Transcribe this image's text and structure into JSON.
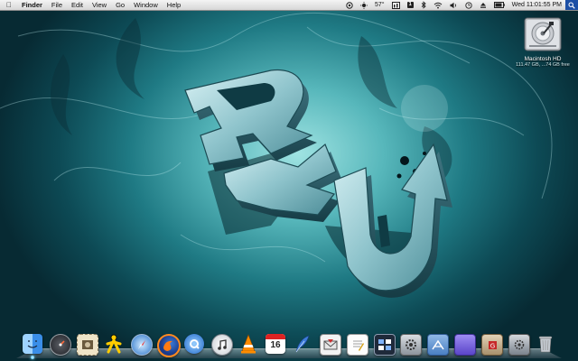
{
  "menubar": {
    "apple_icon": "apple-icon",
    "app_name": "Finder",
    "menus": [
      "File",
      "Edit",
      "View",
      "Go",
      "Window",
      "Help"
    ],
    "extras": {
      "temperature": "57°",
      "clock": "Wed 11:01:55 PM",
      "spaces_number": "1"
    }
  },
  "desktop": {
    "drive": {
      "name": "Macintosh HD",
      "info": "111.47 GB, ...74 GB free"
    }
  },
  "dock": {
    "items": [
      {
        "name": "finder-icon",
        "running": true
      },
      {
        "name": "dashboard-icon",
        "running": false
      },
      {
        "name": "mail-stamp-icon",
        "running": false
      },
      {
        "name": "aim-icon",
        "running": false
      },
      {
        "name": "safari-icon",
        "running": false
      },
      {
        "name": "firefox-icon",
        "running": false
      },
      {
        "name": "quicktime-icon",
        "running": false
      },
      {
        "name": "itunes-icon",
        "running": false
      },
      {
        "name": "vlc-icon",
        "running": false
      },
      {
        "name": "ical-icon",
        "running": false,
        "label": "16"
      },
      {
        "name": "feather-icon",
        "running": false
      },
      {
        "name": "mail-icon",
        "running": false
      },
      {
        "name": "textedit-icon",
        "running": false
      },
      {
        "name": "spaces-icon",
        "running": false
      },
      {
        "name": "system-preferences-icon",
        "running": false
      },
      {
        "name": "applications-stack-icon",
        "running": false
      },
      {
        "name": "documents-stack-icon",
        "running": false
      },
      {
        "name": "downloads-stack-icon",
        "running": false
      },
      {
        "name": "utilities-stack-icon",
        "running": false
      },
      {
        "name": "trash-icon",
        "running": false
      }
    ]
  }
}
